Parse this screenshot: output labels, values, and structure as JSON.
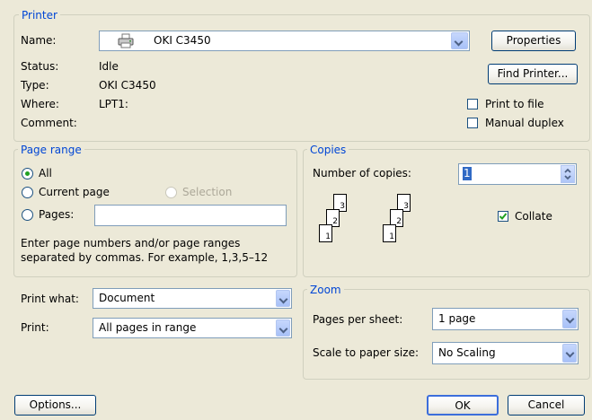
{
  "printer": {
    "group_label": "Printer",
    "name_label": "Name:",
    "name_value": "OKI C3450",
    "properties_button": "Properties",
    "find_printer_button": "Find Printer...",
    "status_label": "Status:",
    "status_value": "Idle",
    "type_label": "Type:",
    "type_value": "OKI C3450",
    "where_label": "Where:",
    "where_value": "LPT1:",
    "comment_label": "Comment:",
    "print_to_file_label": "Print to file",
    "print_to_file_checked": false,
    "manual_duplex_label": "Manual duplex",
    "manual_duplex_checked": false
  },
  "page_range": {
    "group_label": "Page range",
    "all_label": "All",
    "current_page_label": "Current page",
    "selection_label": "Selection",
    "pages_label": "Pages:",
    "pages_value": "",
    "selected": "all",
    "hint": "Enter page numbers and/or page ranges separated by commas.  For example, 1,3,5–12"
  },
  "copies": {
    "group_label": "Copies",
    "number_label": "Number of copies:",
    "number_value": "1",
    "collate_label": "Collate",
    "collate_checked": true
  },
  "print_what": {
    "label": "Print what:",
    "value": "Document"
  },
  "print": {
    "label": "Print:",
    "value": "All pages in range"
  },
  "zoom": {
    "group_label": "Zoom",
    "pages_per_sheet_label": "Pages per sheet:",
    "pages_per_sheet_value": "1 page",
    "scale_label": "Scale to paper size:",
    "scale_value": "No Scaling"
  },
  "footer": {
    "options_button": "Options...",
    "ok_button": "OK",
    "cancel_button": "Cancel"
  }
}
